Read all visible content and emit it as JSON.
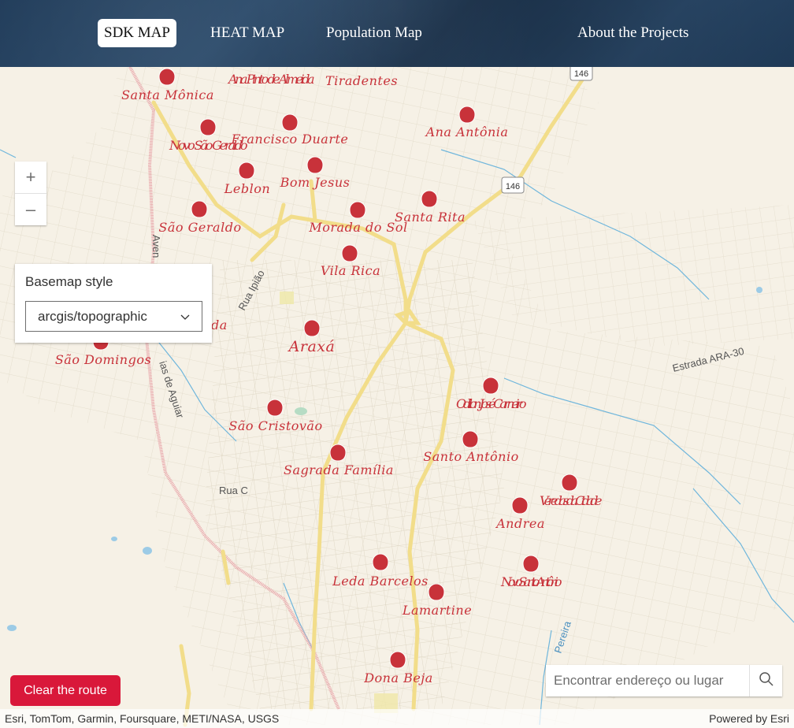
{
  "nav": {
    "links": [
      {
        "label": "SDK MAP",
        "active": true
      },
      {
        "label": "HEAT MAP",
        "active": false
      },
      {
        "label": "Population Map",
        "active": false
      },
      {
        "label": "About the Projects",
        "active": false
      }
    ]
  },
  "zoom": {
    "in_symbol": "+",
    "out_symbol": "–"
  },
  "basemap": {
    "title": "Basemap style",
    "selected": "arcgis/topographic"
  },
  "clear_route": {
    "label": "Clear the route"
  },
  "search": {
    "placeholder": "Encontrar endereço ou lugar"
  },
  "attribution": {
    "sources": "Esri, TomTom, Garmin, Foursquare, METI/NASA, USGS",
    "powered": "Powered by Esri"
  },
  "map": {
    "neighborhoods": [
      {
        "name": "Santa Mônica"
      },
      {
        "name": "Ana Pinto de Almeida"
      },
      {
        "name": "Tiradentes"
      },
      {
        "name": "Ana Antônia"
      },
      {
        "name": "Novo São Geraldo"
      },
      {
        "name": "Francisco Duarte"
      },
      {
        "name": "Leblon"
      },
      {
        "name": "Bom Jesus"
      },
      {
        "name": "São Geraldo"
      },
      {
        "name": "Morada do Sol"
      },
      {
        "name": "Santa Rita"
      },
      {
        "name": "Vila Rica"
      },
      {
        "name": "Araxá"
      },
      {
        "name": "São Domingos"
      },
      {
        "name": "Odilon José Carneiro"
      },
      {
        "name": "São Cristovão"
      },
      {
        "name": "Santo Antônio"
      },
      {
        "name": "Sagrada Família"
      },
      {
        "name": "Veredas da Cidade"
      },
      {
        "name": "Andrea"
      },
      {
        "name": "Leda Barcelos"
      },
      {
        "name": "Novo Santo Antônio"
      },
      {
        "name": "Lamartine"
      },
      {
        "name": "Dona Beja"
      }
    ],
    "road_labels": {
      "highway_shield_1": "146",
      "highway_shield_2": "146",
      "rua_ipiao": "Rua Ipião",
      "estrada": "Estrada ARA-30",
      "rua_c": "Rua C",
      "avenida": "Aven",
      "dias_de_aguiar": "ias de Aguiar",
      "pereira": "Pereira",
      "basemap_partial": "da"
    },
    "colors": {
      "marker": "#c8323a",
      "major_road": "#f2dd8a",
      "rail": "#e8a3a8",
      "water": "#6fb6dc",
      "background": "#f6f1e6"
    }
  }
}
